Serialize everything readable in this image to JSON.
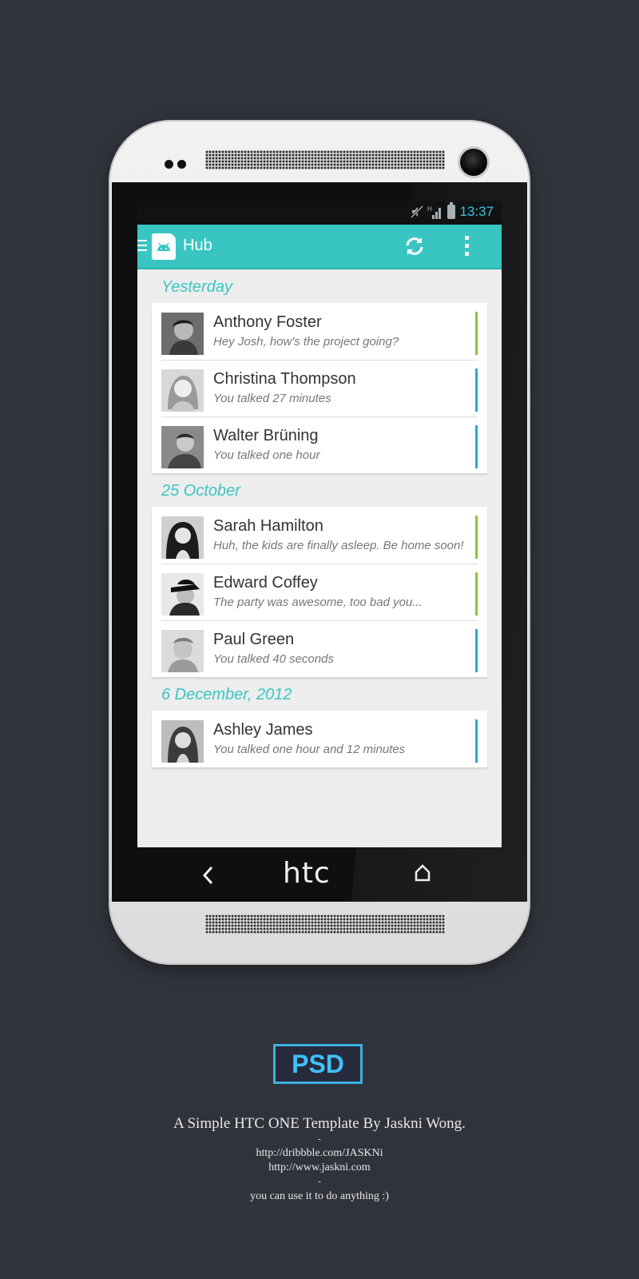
{
  "status_bar": {
    "time": "13:37",
    "network_label": "H"
  },
  "action_bar": {
    "title": "Hub",
    "refresh_icon": "refresh-icon",
    "overflow_icon": "overflow-menu-icon"
  },
  "sections": [
    {
      "header": "Yesterday",
      "items": [
        {
          "name": "Anthony Foster",
          "subtitle": "Hey Josh, how's the project going?",
          "accent": "#8cc43a"
        },
        {
          "name": "Christina Thompson",
          "subtitle": "You talked 27 minutes",
          "accent": "#2aa6d2"
        },
        {
          "name": "Walter Brüning",
          "subtitle": "You talked one hour",
          "accent": "#2aa6d2"
        }
      ]
    },
    {
      "header": "25 October",
      "items": [
        {
          "name": "Sarah Hamilton",
          "subtitle": "Huh, the kids are finally asleep. Be home soon!",
          "accent": "#8cc43a"
        },
        {
          "name": "Edward Coffey",
          "subtitle": "The party was awesome, too bad you...",
          "accent": "#8cc43a"
        },
        {
          "name": "Paul Green",
          "subtitle": "You talked 40 seconds",
          "accent": "#2aa6d2"
        }
      ]
    },
    {
      "header": "6 December, 2012",
      "items": [
        {
          "name": "Ashley James",
          "subtitle": "You talked one hour and 12 minutes",
          "accent": "#2aa6d2"
        }
      ]
    }
  ],
  "nav_bar": {
    "logo": "htc",
    "back_icon": "back-icon",
    "home_icon": "home-icon"
  },
  "footer": {
    "badge": "PSD",
    "line1": "A Simple HTC ONE Template By Jaskni Wong.",
    "sep1": "-",
    "link1": "http://dribbble.com/JASKNi",
    "link2": "http://www.jaskni.com",
    "sep2": "-",
    "line2": "you can use it to do anything :)"
  },
  "colors": {
    "accent_teal": "#39c6c3",
    "green": "#8cc43a",
    "blue": "#2aa6d2",
    "background": "#30333b"
  }
}
